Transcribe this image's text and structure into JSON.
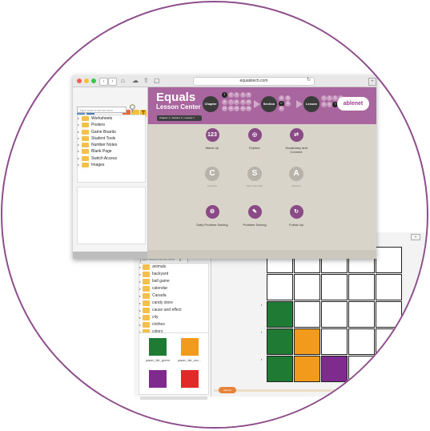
{
  "browser": {
    "url": "equalstech.com"
  },
  "sidebar": {
    "search_placeholder": "Type search terms here",
    "items": [
      "Worksheets",
      "Posters",
      "Game Boards",
      "Student Tools",
      "Number Notes",
      "Blank Page",
      "Switch Access",
      "Images"
    ]
  },
  "header": {
    "title": "Equals",
    "subtitle": "Lesson Center",
    "breadcrumb": "Chapter 1 • Section C • Lesson 7",
    "chapter_label": "Chapter",
    "section_label": "Section",
    "lesson_label": "Lesson",
    "chapter_value": "1",
    "section_value": "C",
    "lesson_value": "7",
    "brand": "ablenet",
    "chapter_numbers": [
      "1",
      "2",
      "3",
      "4",
      "5",
      "6",
      "7",
      "8",
      "9",
      "10",
      "11",
      "12",
      "13",
      "14",
      "15"
    ],
    "section_letters": [
      "A",
      "B",
      "C",
      "D",
      "E"
    ],
    "lesson_numbers": [
      "1",
      "2",
      "3",
      "4",
      "5",
      "6",
      "7",
      "8"
    ]
  },
  "menu": {
    "row1": [
      {
        "label": "Warm Up",
        "icon": "123"
      },
      {
        "label": "Explore",
        "icon": "◎"
      },
      {
        "label": "Vocabulary and Connect",
        "icon": "⇄"
      }
    ],
    "row2": [
      {
        "label": "Concrete",
        "icon": "C"
      },
      {
        "label": "Semi-Concrete",
        "icon": "S"
      },
      {
        "label": "Abstract",
        "icon": "A"
      }
    ],
    "row3": [
      {
        "label": "Daily Problem Solving",
        "icon": "⚙"
      },
      {
        "label": "Problem Solving",
        "icon": "✎"
      },
      {
        "label": "Follow Up",
        "icon": "↻"
      }
    ]
  },
  "back_window": {
    "search_placeholder": "Type search terms here",
    "items": [
      "animals",
      "backyard",
      "ball game",
      "calendar",
      "Canada",
      "candy store",
      "cause and effect",
      "city",
      "clothes",
      "colors"
    ],
    "tiles": [
      {
        "label": "paper_tile_green",
        "color": "#1f7a34"
      },
      {
        "label": "paper_tile_ora...",
        "color": "#f29a1c"
      },
      {
        "label": "",
        "color": "#7f2b8d"
      },
      {
        "label": "",
        "color": "#e12929"
      }
    ],
    "slider_label": "ablenet"
  },
  "colors": {
    "accent": "#a9659d",
    "ring": "#8e4e8c",
    "green": "#1f7a34",
    "orange": "#f29a1c",
    "purple": "#7f2b8d"
  }
}
